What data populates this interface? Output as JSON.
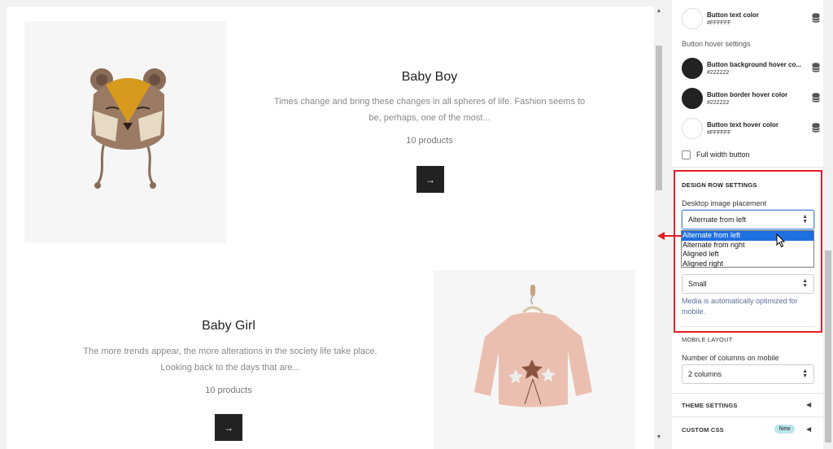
{
  "preview": {
    "collections": [
      {
        "title": "Baby Boy",
        "description": "Times change and bring these changes in all spheres of life. Fashion seems to be, perhaps, one of the most...",
        "count": "10 products",
        "arrow": "→"
      },
      {
        "title": "Baby Girl",
        "description": "The more trends appear, the more alterations in the society life take place. Looking back to the days that are...",
        "count": "10 products",
        "arrow": "→"
      }
    ]
  },
  "sidebar": {
    "button_text_color": {
      "label": "Button text color",
      "hex": "#FFFFFF"
    },
    "hover_heading": "Button hover settings",
    "hover_colors": [
      {
        "label": "Button background hover co...",
        "hex": "#222222"
      },
      {
        "label": "Button border hover color",
        "hex": "#222222"
      },
      {
        "label": "Button text hover color",
        "hex": "#FFFFFF"
      }
    ],
    "full_width_label": "Full width button",
    "design_row": {
      "heading": "DESIGN ROW SETTINGS",
      "placement_label": "Desktop image placement",
      "placement_value": "Alternate from left",
      "placement_options": [
        "Alternate from left",
        "Alternate from right",
        "Aligned left",
        "Aligned right"
      ],
      "media_width_value": "Small",
      "helper": "Media is automatically optimized for mobile."
    },
    "mobile_layout": {
      "heading": "MOBILE LAYOUT",
      "columns_label": "Number of columns on mobile",
      "columns_value": "2 columns"
    },
    "sections": [
      {
        "title": "THEME SETTINGS"
      },
      {
        "title": "CUSTOM CSS",
        "badge": "New"
      }
    ]
  },
  "colors": {
    "accent_red": "#e41e26",
    "dropdown_selected": "#1e6fe0",
    "dark": "#222222",
    "badge": "#b9e6ea"
  }
}
